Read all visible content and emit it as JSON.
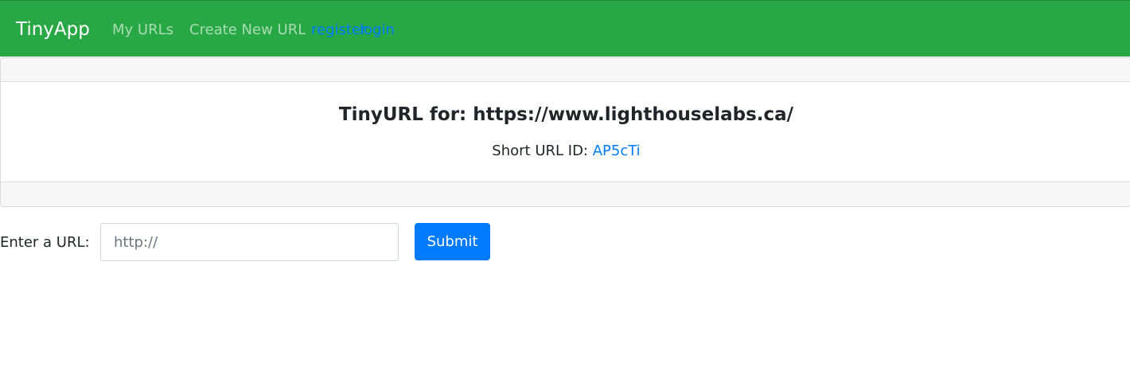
{
  "navbar": {
    "brand": "TinyApp",
    "links": {
      "my_urls": "My URLs",
      "create_new_url": "Create New URL",
      "register": "register",
      "login": "login"
    },
    "colors": {
      "background": "#28a745",
      "auth_link": "#007bff"
    }
  },
  "card": {
    "title": "TinyURL for: https://www.lighthouselabs.ca/",
    "short_url_label": "Short URL ID: ",
    "short_url_id": "AP5cTi"
  },
  "form": {
    "label": "Enter a URL:",
    "input_placeholder": "http://",
    "input_value": "",
    "submit_label": "Submit",
    "colors": {
      "submit": "#007bff"
    }
  }
}
